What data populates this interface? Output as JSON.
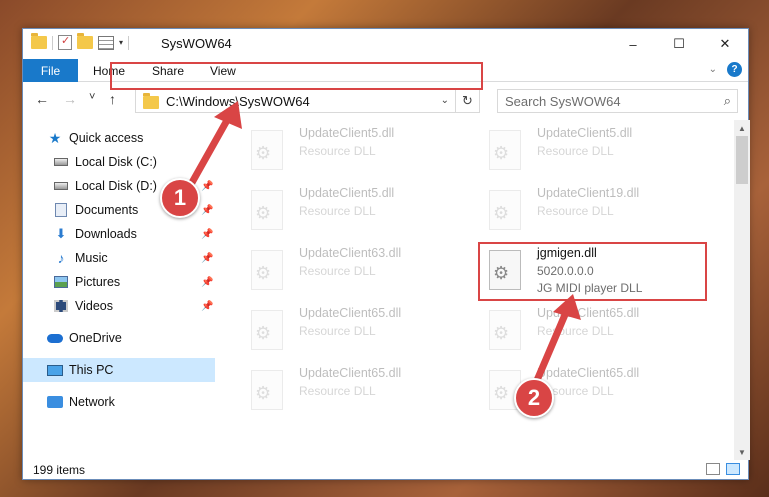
{
  "titlebar": {
    "title": "SysWOW64",
    "minimize": "–",
    "maximize": "☐",
    "close": "✕"
  },
  "ribbon": {
    "tabs": [
      {
        "label": "File",
        "active": true
      },
      {
        "label": "Home"
      },
      {
        "label": "Share"
      },
      {
        "label": "View"
      }
    ],
    "expand_icon": "chevron-down-icon",
    "help": "?"
  },
  "nav": {
    "back": "←",
    "forward": "→",
    "recent": "˅",
    "up": "↑",
    "address": "C:\\Windows\\SysWOW64",
    "address_dropdown": "⌄",
    "refresh": "↻",
    "search_placeholder": "Search SysWOW64"
  },
  "sidebar": {
    "items": [
      {
        "label": "Quick access",
        "icon": "star-icon"
      },
      {
        "label": "Local Disk (C:)",
        "icon": "disk-icon"
      },
      {
        "label": "Local Disk (D:)",
        "icon": "disk-icon",
        "pinned": true
      },
      {
        "label": "Documents",
        "icon": "documents-icon",
        "pinned": true
      },
      {
        "label": "Downloads",
        "icon": "download-icon",
        "pinned": true
      },
      {
        "label": "Music",
        "icon": "music-icon",
        "pinned": true
      },
      {
        "label": "Pictures",
        "icon": "pictures-icon",
        "pinned": true
      },
      {
        "label": "Videos",
        "icon": "videos-icon",
        "pinned": true
      },
      {
        "label": "OneDrive",
        "icon": "onedrive-icon"
      },
      {
        "label": "This PC",
        "icon": "pc-icon",
        "selected": true
      },
      {
        "label": "Network",
        "icon": "network-icon"
      }
    ]
  },
  "files": [
    {
      "name": "UpdateClient5.dll",
      "type": "Resource DLL",
      "dim": true
    },
    {
      "name": "UpdateClient5.dll",
      "type": "Resource DLL",
      "dim": true
    },
    {
      "name": "UpdateClient5.dll",
      "type": "Resource DLL",
      "dim": true
    },
    {
      "name": "UpdateClient19.dll",
      "type": "Resource DLL",
      "dim": true
    },
    {
      "name": "UpdateClient63.dll",
      "type": "Resource DLL",
      "dim": true
    },
    {
      "name": "jgmigen.dll",
      "version": "5020.0.0.0",
      "type": "JG MIDI player DLL",
      "dim": false
    },
    {
      "name": "UpdateClient65.dll",
      "type": "Resource DLL",
      "dim": true
    },
    {
      "name": "UpdateClient65.dll",
      "type": "Resource DLL",
      "dim": true
    },
    {
      "name": "UpdateClient65.dll",
      "type": "Resource DLL",
      "dim": true
    },
    {
      "name": "UpdateClient65.dll",
      "type": "Resource DLL",
      "dim": true
    }
  ],
  "status": {
    "item_count": "199 items"
  },
  "callouts": [
    "1",
    "2"
  ],
  "colors": {
    "accent": "#1979ca",
    "highlight": "#d94545",
    "selected": "#cce8ff"
  }
}
